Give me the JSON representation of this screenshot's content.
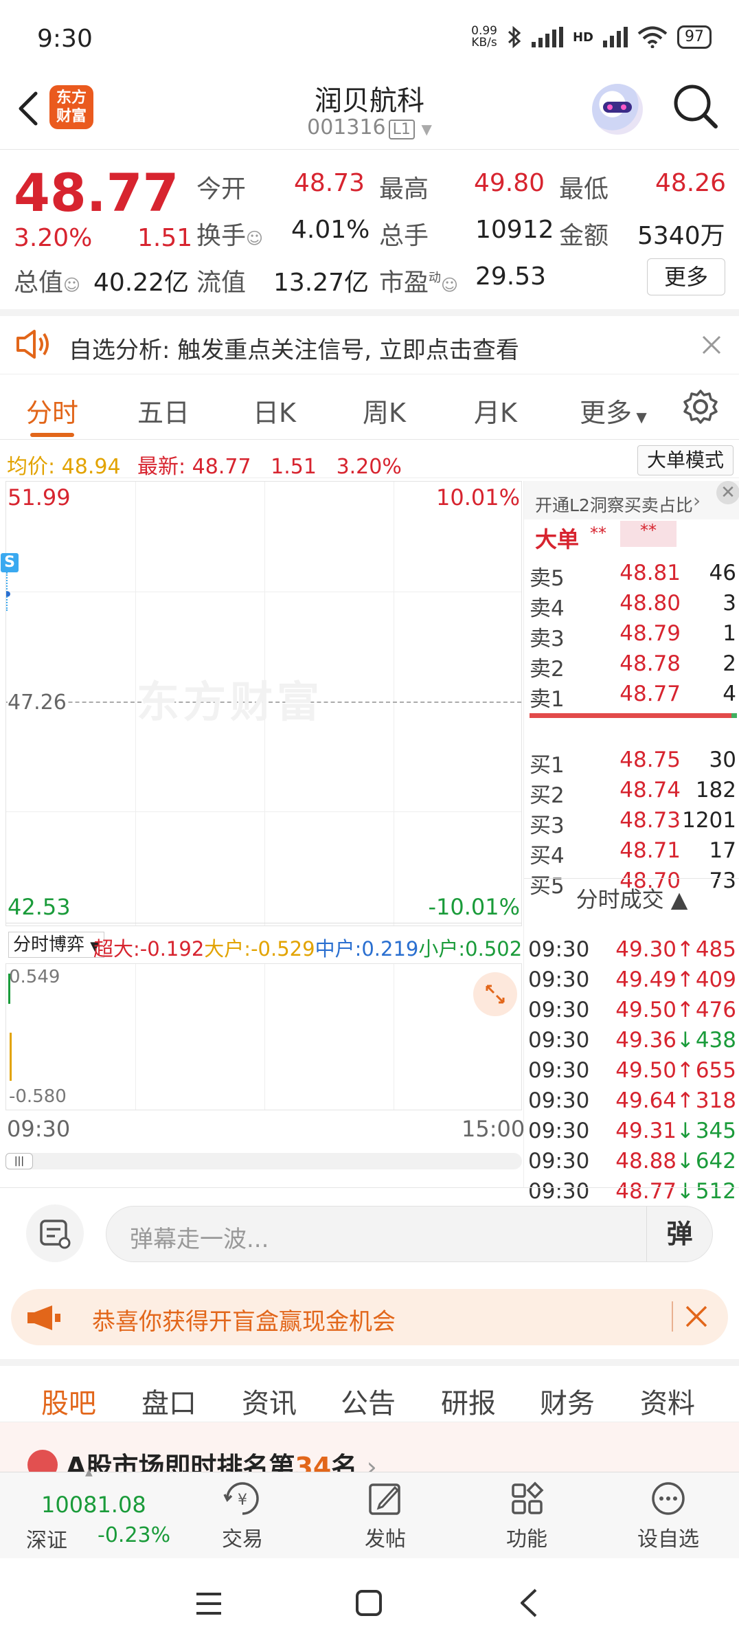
{
  "status": {
    "time": "9:30",
    "net_speed": "0.99\nKB/s",
    "net_speed_top": "0.99",
    "net_speed_bottom": "KB/s",
    "signal1": "",
    "hd": "HD",
    "battery": "97"
  },
  "header": {
    "logo_top": "东方",
    "logo_bottom": "财富",
    "name": "润贝航科",
    "code": "001316",
    "level": "L1"
  },
  "quote": {
    "price": "48.77",
    "pct": "3.20%",
    "change": "1.51",
    "open_label": "今开",
    "open": "48.73",
    "high_label": "最高",
    "high": "49.80",
    "low_label": "最低",
    "low": "48.26",
    "turnover_label": "换手",
    "turnover": "4.01%",
    "vol_label": "总手",
    "vol": "10912",
    "amount_label": "金额",
    "amount": "5340万",
    "mcap_label": "总值",
    "mcap": "40.22亿",
    "float_label": "流值",
    "float": "13.27亿",
    "pe_label": "市盈",
    "pe_sup": "动",
    "pe": "29.53",
    "more": "更多"
  },
  "notice": {
    "text": "自选分析: 触发重点关注信号, 立即点击查看"
  },
  "chart_tabs": [
    "分时",
    "五日",
    "日K",
    "周K",
    "月K",
    "更多"
  ],
  "avg_line": {
    "avg_label": "均价:",
    "avg": "48.94",
    "latest_label": "最新:",
    "latest": "48.77",
    "change": "1.51",
    "pct": "3.20%",
    "bigorder_btn": "大单模式"
  },
  "chart": {
    "y_top": "51.99",
    "y_mid": "47.26",
    "y_bottom": "42.53",
    "pct_top": "10.01%",
    "pct_bottom": "-10.01%",
    "watermark": "东方财富",
    "s_marker": "S",
    "x_start": "09:30",
    "x_end": "15:00"
  },
  "chart_data": {
    "type": "line",
    "ylim": [
      42.53,
      51.99
    ],
    "x": [
      "09:30"
    ],
    "series": [
      {
        "values": [
          49.58
        ]
      }
    ]
  },
  "game": {
    "selector": "分时博弈",
    "items": [
      {
        "label": "超大:",
        "value": "-0.192",
        "color": "#d7242f"
      },
      {
        "label": "大户:",
        "value": "-0.529",
        "color": "#e2a300"
      },
      {
        "label": "中户:",
        "value": "0.219",
        "color": "#2a6fd0"
      },
      {
        "label": "小户:",
        "value": "0.502",
        "color": "#1a9b3a"
      }
    ],
    "y_top": "0.549",
    "y_bottom": "-0.580"
  },
  "book": {
    "l2_text": "开通L2洞察买卖占比",
    "bigorder": "大单",
    "stars1": "**",
    "stars2": "**",
    "asks": [
      {
        "label": "卖5",
        "price": "48.81",
        "vol": "46"
      },
      {
        "label": "卖4",
        "price": "48.80",
        "vol": "3"
      },
      {
        "label": "卖3",
        "price": "48.79",
        "vol": "1"
      },
      {
        "label": "卖2",
        "price": "48.78",
        "vol": "2"
      },
      {
        "label": "卖1",
        "price": "48.77",
        "vol": "4"
      }
    ],
    "bids": [
      {
        "label": "买1",
        "price": "48.75",
        "vol": "30"
      },
      {
        "label": "买2",
        "price": "48.74",
        "vol": "182"
      },
      {
        "label": "买3",
        "price": "48.73",
        "vol": "1201"
      },
      {
        "label": "买4",
        "price": "48.71",
        "vol": "17"
      },
      {
        "label": "买5",
        "price": "48.70",
        "vol": "73"
      }
    ],
    "trades_title": "分时成交",
    "trades": [
      {
        "time": "09:30",
        "price": "49.30",
        "dir": "↑",
        "vol": "485",
        "up": true
      },
      {
        "time": "09:30",
        "price": "49.49",
        "dir": "↑",
        "vol": "409",
        "up": true
      },
      {
        "time": "09:30",
        "price": "49.50",
        "dir": "↑",
        "vol": "476",
        "up": true
      },
      {
        "time": "09:30",
        "price": "49.36",
        "dir": "↓",
        "vol": "438",
        "up": false
      },
      {
        "time": "09:30",
        "price": "49.50",
        "dir": "↑",
        "vol": "655",
        "up": true
      },
      {
        "time": "09:30",
        "price": "49.64",
        "dir": "↑",
        "vol": "318",
        "up": true
      },
      {
        "time": "09:30",
        "price": "49.31",
        "dir": "↓",
        "vol": "345",
        "up": false
      },
      {
        "time": "09:30",
        "price": "48.88",
        "dir": "↓",
        "vol": "642",
        "up": false
      },
      {
        "time": "09:30",
        "price": "48.77",
        "dir": "↓",
        "vol": "512",
        "up": false
      }
    ]
  },
  "danmu": {
    "placeholder": "弹幕走一波...",
    "toggle": "弹"
  },
  "promo": {
    "text": "恭喜你获得开盲盒赢现金机会"
  },
  "info_tabs": [
    "股吧",
    "盘口",
    "资讯",
    "公告",
    "研报",
    "财务",
    "资料"
  ],
  "rank": {
    "prefix": "A股市场即时排名第",
    "num": "34",
    "suffix": "名"
  },
  "bottom": {
    "index_value": "10081.08",
    "index_name": "深证",
    "index_change": "-0.23%",
    "items": [
      "交易",
      "发帖",
      "功能",
      "设自选"
    ]
  },
  "colors": {
    "up": "#d7242f",
    "down": "#1a9b3a",
    "accent": "#e2661a"
  }
}
